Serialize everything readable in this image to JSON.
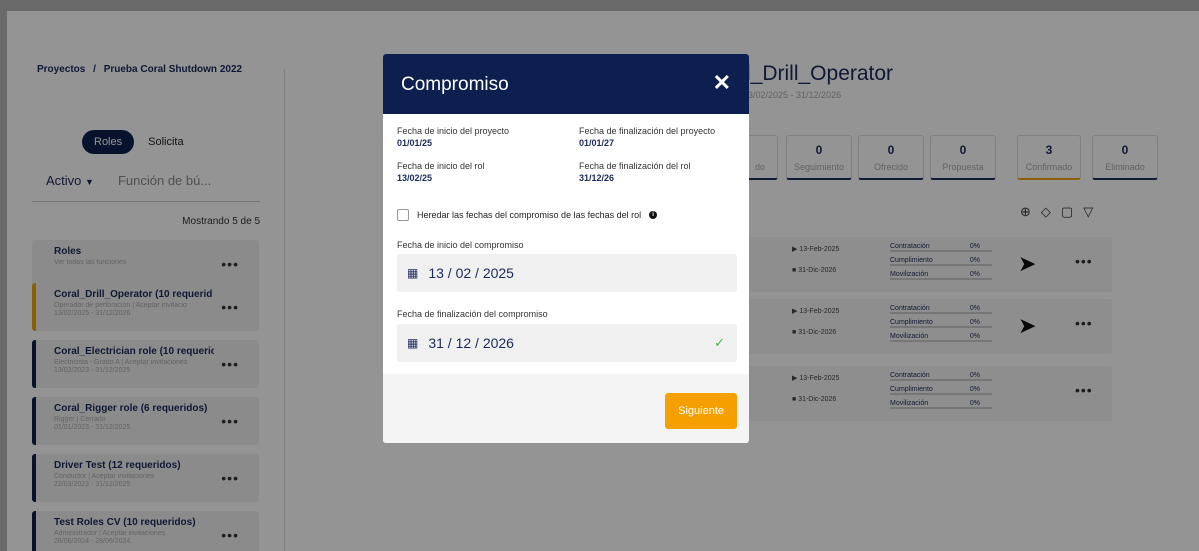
{
  "breadcrumb": {
    "root": "Proyectos",
    "sep": "/",
    "project": "Prueba Coral Shutdown 2022"
  },
  "toggle": {
    "roles": "Roles",
    "solicita": "Solicita"
  },
  "filter": {
    "status": "Activo",
    "search_placeholder": "Función de bú..."
  },
  "showing": "Mostrando 5 de 5",
  "cards": [
    {
      "title": "Roles",
      "sub": "Ver todas las funciones",
      "dates": ""
    },
    {
      "title": "Coral_Drill_Operator (10 requerid",
      "sub": "Operador de perforación | Aceptar invitacio",
      "dates": "13/02/2025 - 31/12/2026"
    },
    {
      "title": "Coral_Electrician role (10 requeric",
      "sub": "Electricista - Grado A | Aceptar invitaciones",
      "dates": "13/02/2023 - 31/12/2025"
    },
    {
      "title": "Coral_Rigger role (6 requeridos)",
      "sub": "Rigger | Cerrado",
      "dates": "01/01/2023 - 31/12/2025"
    },
    {
      "title": "Driver Test (12 requeridos)",
      "sub": "Conductor | Aceptar invitaciones",
      "dates": "22/03/2023 - 31/12/2025"
    },
    {
      "title": "Test Roles CV (10 requeridos)",
      "sub": "Administrador | Aceptar invitaciones",
      "dates": "28/06/2024 - 28/06/2024"
    }
  ],
  "role": {
    "title": "l_Drill_Operator",
    "dates": "3/02/2025 - 31/12/2026"
  },
  "stats": [
    {
      "n": "",
      "l": "do"
    },
    {
      "n": "0",
      "l": "Seguimiento"
    },
    {
      "n": "0",
      "l": "Ofrecido"
    },
    {
      "n": "0",
      "l": "Propuesta"
    },
    {
      "n": "3",
      "l": "Confirmado"
    },
    {
      "n": "0",
      "l": "Eliminado"
    }
  ],
  "rows": [
    {
      "d1": "13-Feb-2025",
      "d2": "31-Dic-2026",
      "p1": "Contratación",
      "v1": "0%",
      "p2": "Cumplimiento",
      "v2": "0%",
      "p3": "Movilización",
      "v3": "0%"
    },
    {
      "d1": "13-Feb-2025",
      "d2": "31-Dic-2026",
      "p1": "Contratación",
      "v1": "0%",
      "p2": "Cumplimiento",
      "v2": "0%",
      "p3": "Movilización",
      "v3": "0%"
    },
    {
      "d1": "13-Feb-2025",
      "d2": "31-Dic-2026",
      "p1": "Contratación",
      "v1": "0%",
      "p2": "Cumplimiento",
      "v2": "0%",
      "p3": "Movilización",
      "v3": "0%"
    }
  ],
  "modal": {
    "title": "Compromiso",
    "close": "✕",
    "proj_start_label": "Fecha de inicio del proyecto",
    "proj_start": "01/01/25",
    "proj_end_label": "Fecha de finalización del proyecto",
    "proj_end": "01/01/27",
    "role_start_label": "Fecha de inicio del rol",
    "role_start": "13/02/25",
    "role_end_label": "Fecha de finalización del rol",
    "role_end": "31/12/26",
    "inherit_label": "Heredar las fechas del compromiso de las fechas del rol",
    "start_label": "Fecha de inicio del compromiso",
    "start_value": "13 / 02 / 2025",
    "end_label": "Fecha de finalización del compromiso",
    "end_value": "31 / 12 / 2026",
    "next": "Siguiente"
  }
}
